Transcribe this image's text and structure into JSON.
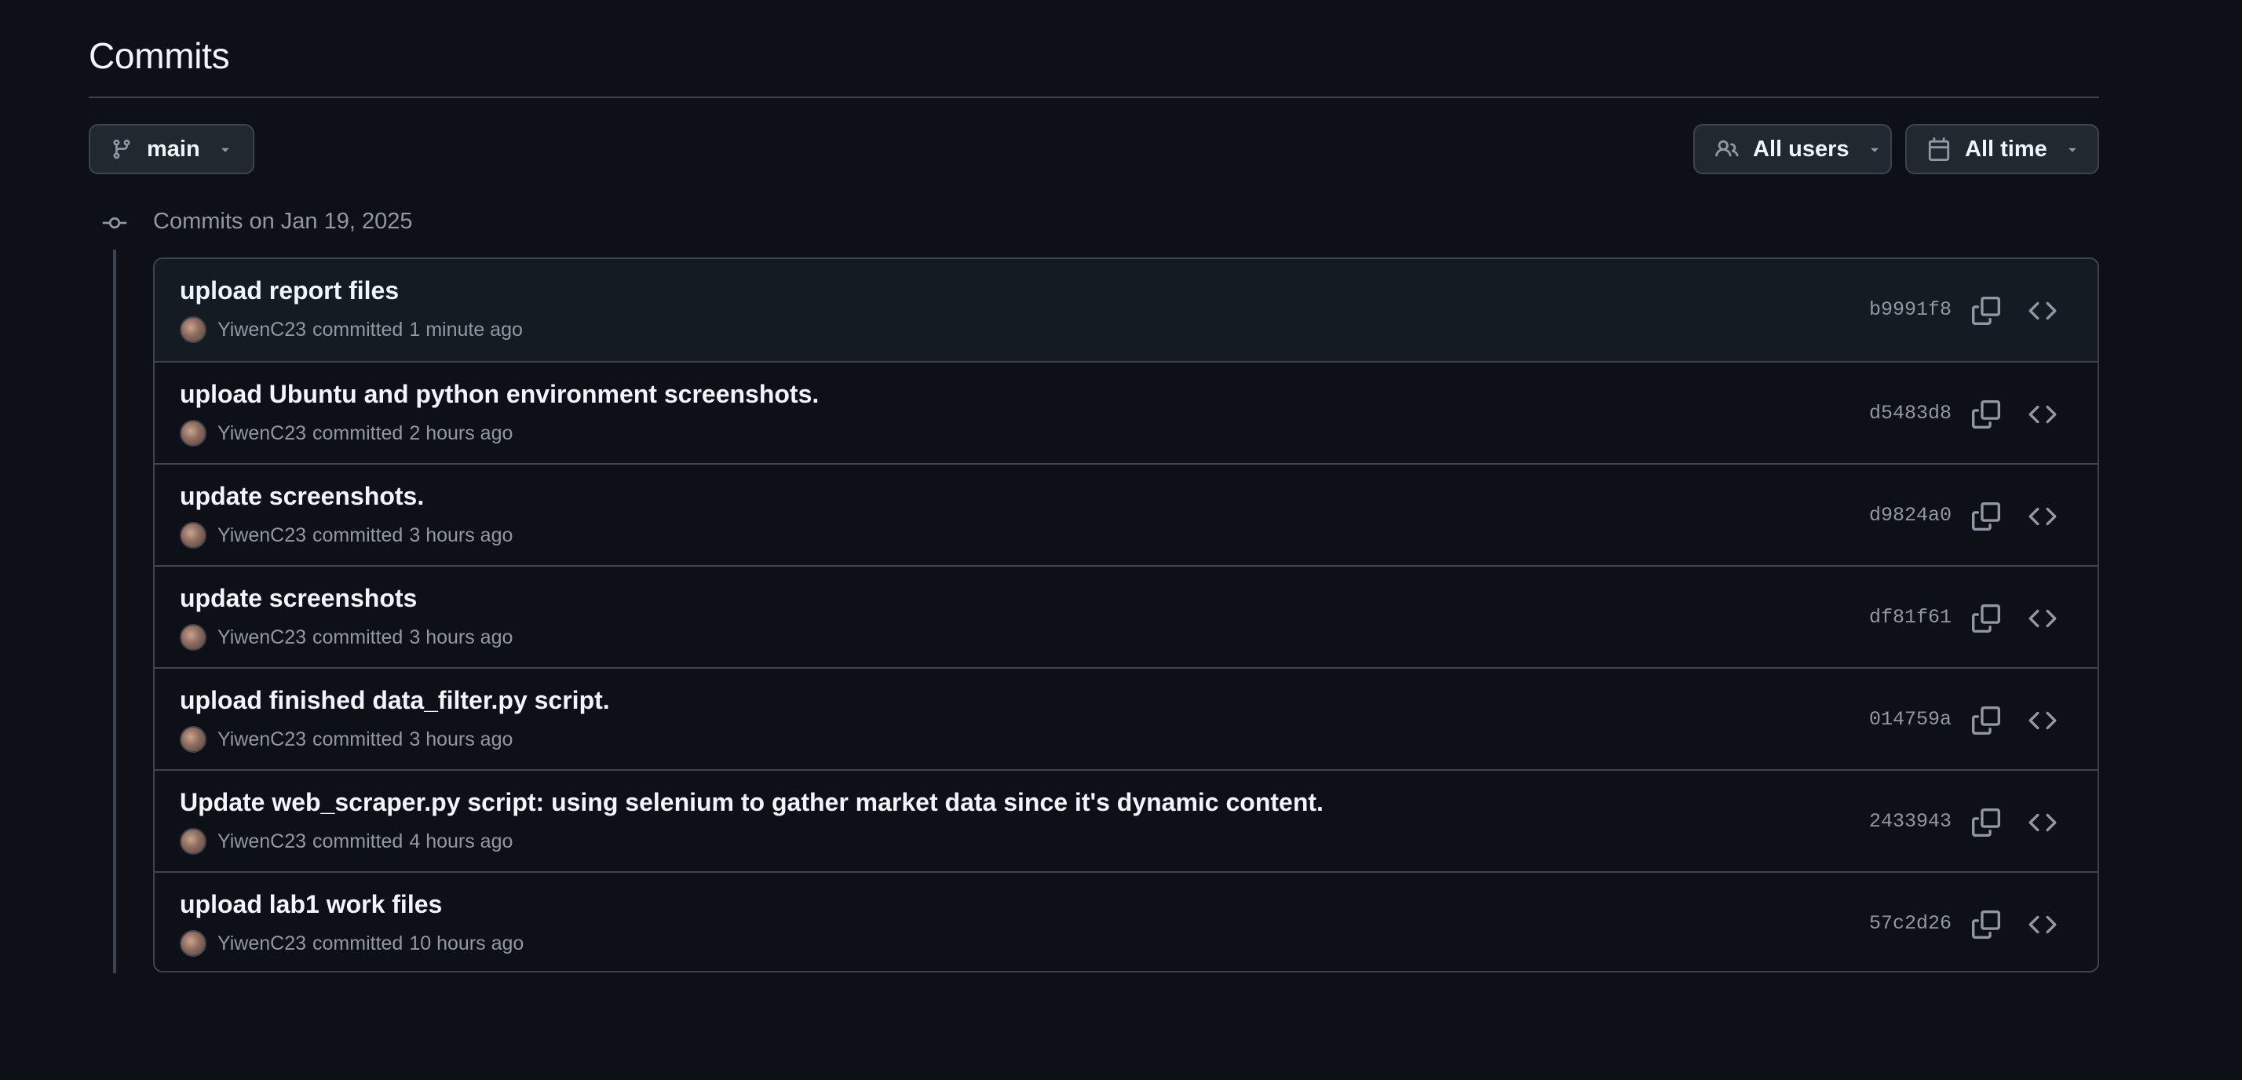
{
  "header": {
    "title": "Commits"
  },
  "filters": {
    "branch": {
      "label": "main",
      "icon": "git-branch-icon"
    },
    "users": {
      "label": "All users",
      "icon": "people-icon"
    },
    "time": {
      "label": "All time",
      "icon": "calendar-icon"
    }
  },
  "timeline": {
    "group_label": "Commits on Jan 19, 2025",
    "icon": "git-commit-icon"
  },
  "commits": [
    {
      "message": "upload report files",
      "author": "YiwenC23",
      "verb": "committed",
      "time": "1 minute ago",
      "sha": "b9991f8"
    },
    {
      "message": "upload Ubuntu and python environment screenshots.",
      "author": "YiwenC23",
      "verb": "committed",
      "time": "2 hours ago",
      "sha": "d5483d8"
    },
    {
      "message": "update screenshots.",
      "author": "YiwenC23",
      "verb": "committed",
      "time": "3 hours ago",
      "sha": "d9824a0"
    },
    {
      "message": "update screenshots",
      "author": "YiwenC23",
      "verb": "committed",
      "time": "3 hours ago",
      "sha": "df81f61"
    },
    {
      "message": "upload finished data_filter.py script.",
      "author": "YiwenC23",
      "verb": "committed",
      "time": "3 hours ago",
      "sha": "014759a"
    },
    {
      "message": "Update web_scraper.py script: using selenium to gather market data since it's dynamic content.",
      "author": "YiwenC23",
      "verb": "committed",
      "time": "4 hours ago",
      "sha": "2433943"
    },
    {
      "message": "upload lab1 work files",
      "author": "YiwenC23",
      "verb": "committed",
      "time": "10 hours ago",
      "sha": "57c2d26"
    }
  ],
  "colors": {
    "background": "#0d1117",
    "row_highlight": "#151b23",
    "border": "#3d444d",
    "text_primary": "#f0f6fc",
    "text_muted": "#9198a1"
  }
}
